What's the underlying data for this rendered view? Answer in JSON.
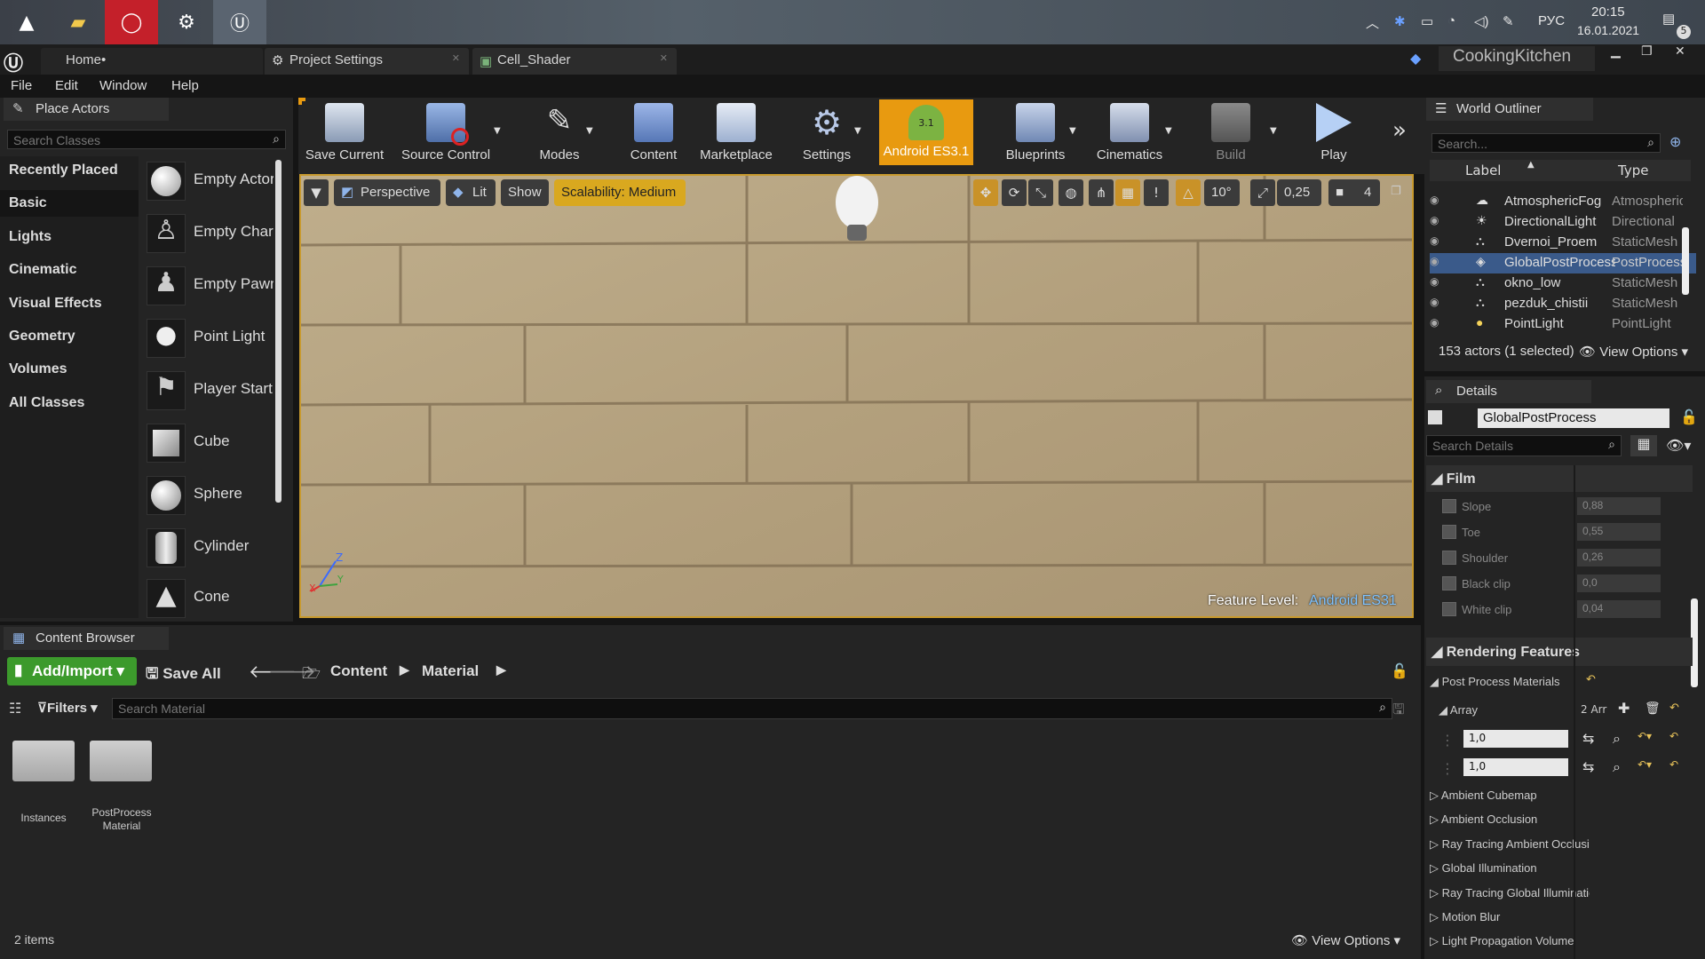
{
  "taskbar": {
    "tray_lang": "РУС",
    "time": "20:15",
    "date": "16.01.2021",
    "notifications_count": "5"
  },
  "tabs": [
    {
      "label": "Home•"
    },
    {
      "label": "Project Settings"
    },
    {
      "label": "Cell_Shader"
    }
  ],
  "project_name": "CookingKitchen",
  "menu": [
    "File",
    "Edit",
    "Window",
    "Help"
  ],
  "place_actors": {
    "title": "Place Actors",
    "search_placeholder": "Search Classes",
    "categories": [
      "Recently Placed",
      "Basic",
      "Lights",
      "Cinematic",
      "Visual Effects",
      "Geometry",
      "Volumes",
      "All Classes"
    ],
    "actors": [
      "Empty Actor",
      "Empty Character",
      "Empty Pawn",
      "Point Light",
      "Player Start",
      "Cube",
      "Sphere",
      "Cylinder",
      "Cone"
    ]
  },
  "toolbar": {
    "items": [
      "Save Current",
      "Source Control",
      "Modes",
      "Content",
      "Marketplace",
      "Settings",
      "Android ES3.1",
      "Blueprints",
      "Cinematics",
      "Build",
      "Play"
    ]
  },
  "viewport": {
    "perspective": "Perspective",
    "lit": "Lit",
    "show": "Show",
    "scalability": "Scalability: Medium",
    "rotate_snap": "10°",
    "scale_snap": "0,25",
    "camera_speed": "4",
    "feature_level_label": "Feature Level:",
    "feature_level_value": "Android ES31"
  },
  "world_outliner": {
    "title": "World Outliner",
    "search_placeholder": "Search...",
    "col_label": "Label",
    "col_type": "Type",
    "rows": [
      {
        "label": "AtmosphericFog",
        "type": "Atmospheric"
      },
      {
        "label": "DirectionalLight",
        "type": "Directional"
      },
      {
        "label": "Dvernoi_Proem",
        "type": "StaticMesh"
      },
      {
        "label": "GlobalPostProcess",
        "type": "PostProcess"
      },
      {
        "label": "okno_low",
        "type": "StaticMesh"
      },
      {
        "label": "pezduk_chistii",
        "type": "StaticMesh"
      },
      {
        "label": "PointLight",
        "type": "PointLight"
      }
    ],
    "status": "153 actors (1 selected)",
    "view_options": "View Options"
  },
  "details": {
    "title": "Details",
    "object_name": "GlobalPostProcess",
    "search_placeholder": "Search Details",
    "film_section": "Film",
    "film_props": [
      {
        "label": "Slope",
        "value": "0,88"
      },
      {
        "label": "Toe",
        "value": "0,55"
      },
      {
        "label": "Shoulder",
        "value": "0,26"
      },
      {
        "label": "Black clip",
        "value": "0,0"
      },
      {
        "label": "White clip",
        "value": "0,04"
      }
    ],
    "rendering_section": "Rendering Features",
    "post_process_materials": "Post Process Materials",
    "array_label": "Array",
    "array_count": "2 Arr",
    "array_values": [
      "1,0",
      "1,0"
    ],
    "subsections": [
      "Ambient Cubemap",
      "Ambient Occlusion",
      "Ray Tracing Ambient Occlusion",
      "Global Illumination",
      "Ray Tracing Global Illumination",
      "Motion Blur",
      "Light Propagation Volume"
    ]
  },
  "content_browser": {
    "title": "Content Browser",
    "add_import": "Add/Import",
    "save_all": "Save All",
    "crumbs": [
      "Content",
      "Material"
    ],
    "filters": "Filters",
    "search_placeholder": "Search Material",
    "folders": [
      {
        "name": "Instances"
      },
      {
        "name": "PostProcess Material"
      }
    ],
    "item_count": "2 items",
    "view_options": "View Options"
  },
  "colors": {
    "accent_orange": "#e89a10",
    "selected_blue": "#3a5a8a",
    "add_green": "#3c9a2c"
  }
}
